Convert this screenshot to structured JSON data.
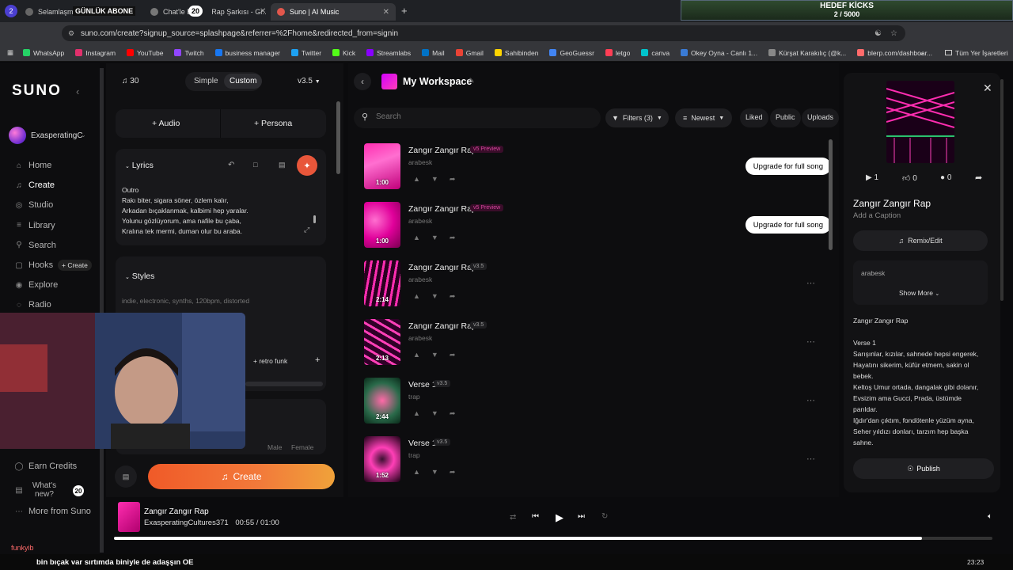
{
  "browser": {
    "tabs": [
      {
        "label": "Selamlaşma",
        "overlay": "GÜNLÜK ABONE",
        "close": "✕"
      },
      {
        "label": "Chat'le Bir",
        "overlay": "20",
        "suffix": "Rap Şarkısı - Gr..",
        "close": "✕"
      },
      {
        "label": "Suno | AI Music",
        "close": "✕",
        "active": true
      }
    ],
    "new_tab": "+",
    "url": "suno.com/create?signup_source=splashpage&referrer=%2Fhome&redirected_from=signin",
    "bookmarks": [
      "WhatsApp",
      "Instagram",
      "YouTube",
      "Twitch",
      "business manager",
      "Twitter",
      "Kick",
      "Streamlabs",
      "Mail",
      "Gmail",
      "Sahibinden",
      "GeoGuessr",
      "letgo",
      "canva",
      "Okey Oyna - Canlı 1...",
      "Kürşat Karakılıç (@k...",
      "blerp.com/dashboar..."
    ],
    "all_bookmarks": "Tüm Yer İşaretleri",
    "profile_badge": "2"
  },
  "overlay_goal": {
    "title": "HEDEF KİCKS",
    "progress": "2 / 5000"
  },
  "sidebar": {
    "logo": "SUNO",
    "user": "ExasperatingC",
    "items": [
      {
        "label": "Home",
        "icon": "home-icon"
      },
      {
        "label": "Create",
        "icon": "create-icon"
      },
      {
        "label": "Studio",
        "icon": "studio-icon"
      },
      {
        "label": "Library",
        "icon": "library-icon"
      },
      {
        "label": "Search",
        "icon": "search-icon"
      },
      {
        "label": "Hooks",
        "icon": "hooks-icon"
      },
      {
        "label": "Explore",
        "icon": "explore-icon"
      },
      {
        "label": "Radio",
        "icon": "radio-icon"
      }
    ],
    "hooks_create": "+ Create",
    "earn_credits": "Earn Credits",
    "whats_new": "What's new?",
    "whats_new_count": "20",
    "more_from_suno": "More from Suno"
  },
  "create": {
    "credits": "30",
    "mode_simple": "Simple",
    "mode_custom": "Custom",
    "version": "v3.5",
    "audio": "+ Audio",
    "persona": "+ Persona",
    "lyrics_title": "Lyrics",
    "lyrics_lines": [
      "Outro",
      "Rakı biter, sigara söner, özlem kalır,",
      "Arkadan bıçaklanmak, kalbimi hep yaralar.",
      "Yolunu gözlüyorum, ama nafile bu çaba,",
      "Kralına tek mermi, duman olur bu araba."
    ],
    "styles_title": "Styles",
    "styles_placeholder": "indie, electronic, synths, 120bpm, distorted",
    "style_tag": "+ retro funk",
    "male": "Male",
    "female": "Female",
    "create_button": "Create"
  },
  "workspace": {
    "title": "My Workspace",
    "search_placeholder": "Search",
    "filters": "Filters (3)",
    "sort": "Newest",
    "liked": "Liked",
    "public": "Public",
    "uploads": "Uploads",
    "upgrade_label": "Upgrade for full song",
    "songs": [
      {
        "title": "Zangır Zangır Rap",
        "badge": "v5 Preview",
        "genre": "arabesk",
        "duration": "1:00",
        "preview": true
      },
      {
        "title": "Zangır Zangır Rap",
        "badge": "v5 Preview",
        "genre": "arabesk",
        "duration": "1:00",
        "preview": true
      },
      {
        "title": "Zangır Zangır Rap",
        "badge": "v3.5",
        "genre": "arabesk",
        "duration": "2:14",
        "preview": false
      },
      {
        "title": "Zangır Zangır Rap",
        "badge": "v3.5",
        "genre": "arabesk",
        "duration": "2:13",
        "preview": false
      },
      {
        "title": "Verse 1",
        "badge": "v3.5",
        "genre": "trap",
        "duration": "2:44",
        "preview": false
      },
      {
        "title": "Verse 1",
        "badge": "v3.5",
        "genre": "trap",
        "duration": "1:52",
        "preview": false
      }
    ]
  },
  "detail": {
    "plays": "1",
    "likes": "0",
    "comments": "0",
    "title": "Zangır Zangır Rap",
    "caption": "Add a Caption",
    "remix": "Remix/Edit",
    "genre": "arabesk",
    "show_more": "Show More",
    "lyrics_lines": [
      "Zangır Zangır Rap",
      "",
      "Verse 1",
      "Sarışınlar, kızılar, sahnede hepsi engerek,",
      "Hayatını sikerim, küfür etmem, sakin ol",
      "bebek.",
      "Keltoş Umur ortada, dangalak gibi dolanır,",
      "Evsizim ama Gucci, Prada, üstümde",
      "parıldar.",
      "Iğdır'dan çıktım, fondötenle yüzüm ayna,",
      "Seher yıldızı donları, tarzım hep başka",
      "sahne."
    ],
    "publish": "Publish"
  },
  "player": {
    "title": "Zangır Zangır Rap",
    "artist": "ExasperatingCultures371",
    "current": "00:55",
    "separator": "/",
    "total": "01:00",
    "progress": 0.92
  },
  "stream": {
    "chat_user": "funkyib",
    "ticker": "bin bıçak var sırtımda biniyle de adaşşın OE",
    "clock": "23:23"
  }
}
